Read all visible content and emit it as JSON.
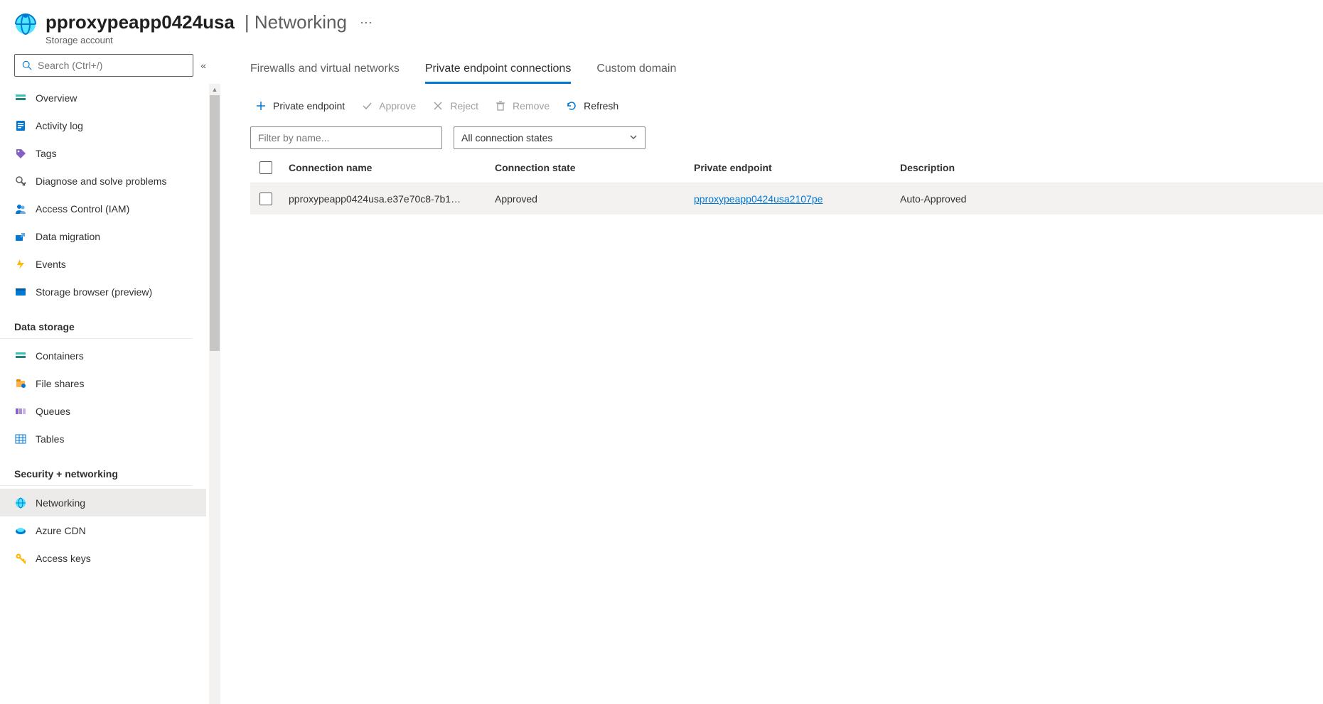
{
  "header": {
    "resource_name": "pproxypeapp0424usa",
    "section": "Networking",
    "subtitle": "Storage account",
    "more": "···"
  },
  "search": {
    "placeholder": "Search (Ctrl+/)"
  },
  "sidebar": {
    "items": [
      {
        "label": "Overview",
        "icon": "overview-icon"
      },
      {
        "label": "Activity log",
        "icon": "activity-log-icon"
      },
      {
        "label": "Tags",
        "icon": "tags-icon"
      },
      {
        "label": "Diagnose and solve problems",
        "icon": "diagnose-icon"
      },
      {
        "label": "Access Control (IAM)",
        "icon": "iam-icon"
      },
      {
        "label": "Data migration",
        "icon": "migration-icon"
      },
      {
        "label": "Events",
        "icon": "events-icon"
      },
      {
        "label": "Storage browser (preview)",
        "icon": "storage-browser-icon"
      }
    ],
    "sections": [
      {
        "title": "Data storage",
        "items": [
          {
            "label": "Containers",
            "icon": "containers-icon"
          },
          {
            "label": "File shares",
            "icon": "file-shares-icon"
          },
          {
            "label": "Queues",
            "icon": "queues-icon"
          },
          {
            "label": "Tables",
            "icon": "tables-icon"
          }
        ]
      },
      {
        "title": "Security + networking",
        "items": [
          {
            "label": "Networking",
            "icon": "networking-icon",
            "selected": true
          },
          {
            "label": "Azure CDN",
            "icon": "cdn-icon"
          },
          {
            "label": "Access keys",
            "icon": "keys-icon"
          }
        ]
      }
    ]
  },
  "tabs": [
    {
      "label": "Firewalls and virtual networks",
      "active": false
    },
    {
      "label": "Private endpoint connections",
      "active": true
    },
    {
      "label": "Custom domain",
      "active": false
    }
  ],
  "toolbar": {
    "add": {
      "label": "Private endpoint"
    },
    "approve": {
      "label": "Approve"
    },
    "reject": {
      "label": "Reject"
    },
    "remove": {
      "label": "Remove"
    },
    "refresh": {
      "label": "Refresh"
    }
  },
  "filters": {
    "name_placeholder": "Filter by name...",
    "state_selected": "All connection states"
  },
  "table": {
    "headers": {
      "name": "Connection name",
      "state": "Connection state",
      "pe": "Private endpoint",
      "desc": "Description"
    },
    "rows": [
      {
        "name": "pproxypeapp0424usa.e37e70c8-7b1…",
        "state": "Approved",
        "pe": "pproxypeapp0424usa2107pe",
        "desc": "Auto-Approved"
      }
    ]
  },
  "colors": {
    "accent": "#0078d4"
  }
}
